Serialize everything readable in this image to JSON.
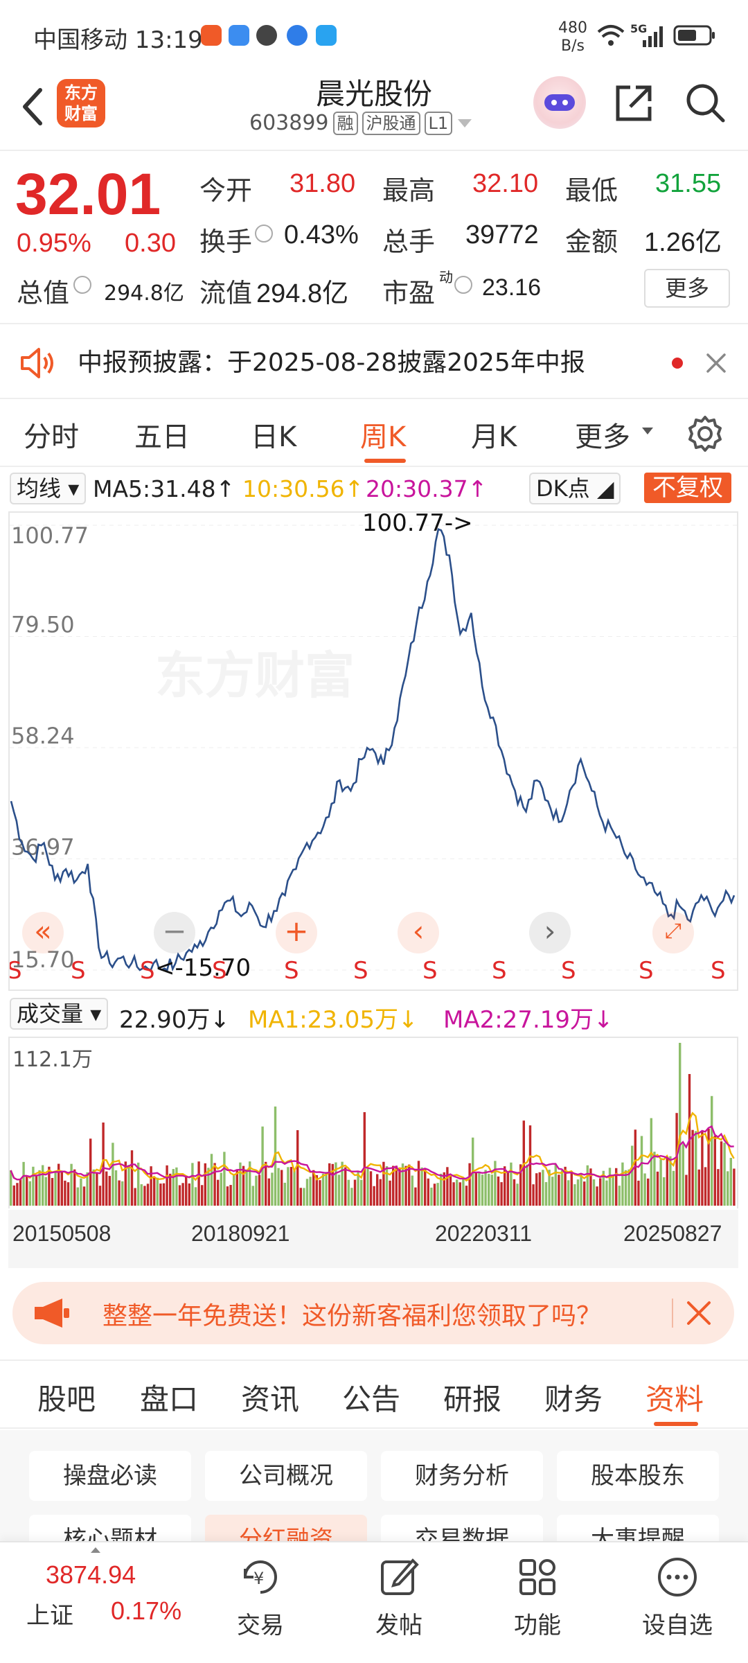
{
  "status_bar": {
    "carrier_time": "中国移动 13:19",
    "net_speed_value": "480",
    "net_speed_unit": "B/s",
    "signal": "5G",
    "app_icons": [
      "taobao-icon",
      "weather-icon",
      "message-icon",
      "browser-icon",
      "bird-icon"
    ]
  },
  "header": {
    "logo_line1": "东方",
    "logo_line2": "财富",
    "stock_name": "晨光股份",
    "stock_code": "603899",
    "tag_margin": "融",
    "tag_connect": "沪股通",
    "tag_level": "L1"
  },
  "quote": {
    "price": "32.01",
    "change_pct": "0.95%",
    "change_amt": "0.30",
    "open_label": "今开",
    "open": "31.80",
    "high_label": "最高",
    "high": "32.10",
    "low_label": "最低",
    "low": "31.55",
    "turnover_label": "换手",
    "turnover": "0.43%",
    "volume_label": "总手",
    "volume": "39772",
    "amount_label": "金额",
    "amount": "1.26亿",
    "mktcap_label": "总值",
    "mktcap": "294.8亿",
    "float_label": "流值",
    "float_cap": "294.8亿",
    "pe_label": "市盈",
    "pe_sup": "动",
    "pe": "23.16",
    "more": "更多"
  },
  "notice": {
    "text": "中报预披露：于2025-08-28披露2025年中报"
  },
  "period_tabs": [
    "分时",
    "五日",
    "日K",
    "周K",
    "月K",
    "更多"
  ],
  "period_active": 3,
  "ma_bar": {
    "indicator": "均线",
    "ma5": "MA5:31.48↑",
    "ma10": "10:30.56↑",
    "ma20": "20:30.37↑",
    "dk": "DK点",
    "adjust": "不复权",
    "colors": {
      "ma5": "#222222",
      "ma10": "#f0b400",
      "ma20": "#c8149c"
    }
  },
  "chart_data": {
    "type": "line",
    "title": "",
    "y_ticks": [
      "100.77",
      "79.50",
      "58.24",
      "36.97",
      "15.70"
    ],
    "ylim": [
      15.7,
      100.77
    ],
    "max_label": "100.77->",
    "min_label": "<-15.70",
    "x_ticks": [
      "20150508",
      "20180921",
      "20220311",
      "20250827"
    ],
    "series": [
      {
        "values": [
          48,
          40,
          37,
          40,
          33,
          35,
          33,
          36,
          20,
          17,
          18,
          17,
          16,
          17,
          16,
          17,
          19,
          20,
          23,
          27,
          29,
          26,
          28,
          24,
          27,
          30,
          35,
          40,
          42,
          45,
          52,
          50,
          56,
          58,
          55,
          62,
          72,
          82,
          90,
          100,
          95,
          80,
          84,
          70,
          64,
          56,
          50,
          46,
          52,
          48,
          44,
          50,
          56,
          50,
          44,
          42,
          38,
          35,
          32,
          30,
          26,
          28,
          25,
          30,
          27,
          29,
          30
        ]
      }
    ],
    "volume": {
      "label": "成交量",
      "current": "22.90万↓",
      "ma1": "MA1:23.05万↓",
      "ma2": "MA2:27.19万↓",
      "max_label": "112.1万",
      "colors": {
        "ma1": "#f0b400",
        "ma2": "#c8149c"
      }
    }
  },
  "promo": {
    "text": "整整一年免费送！这份新客福利您领取了吗？"
  },
  "bottom_tabs": [
    "股吧",
    "盘口",
    "资讯",
    "公告",
    "研报",
    "财务",
    "资料"
  ],
  "bottom_active": 6,
  "chips": [
    "操盘必读",
    "公司概况",
    "财务分析",
    "股本股东",
    "核心题材",
    "分红融资",
    "交易数据",
    "大事提醒"
  ],
  "bottom_nav": {
    "index_value": "3874.94",
    "index_name": "上证",
    "index_change": "0.17%",
    "items": [
      "交易",
      "发帖",
      "功能",
      "设自选"
    ]
  }
}
